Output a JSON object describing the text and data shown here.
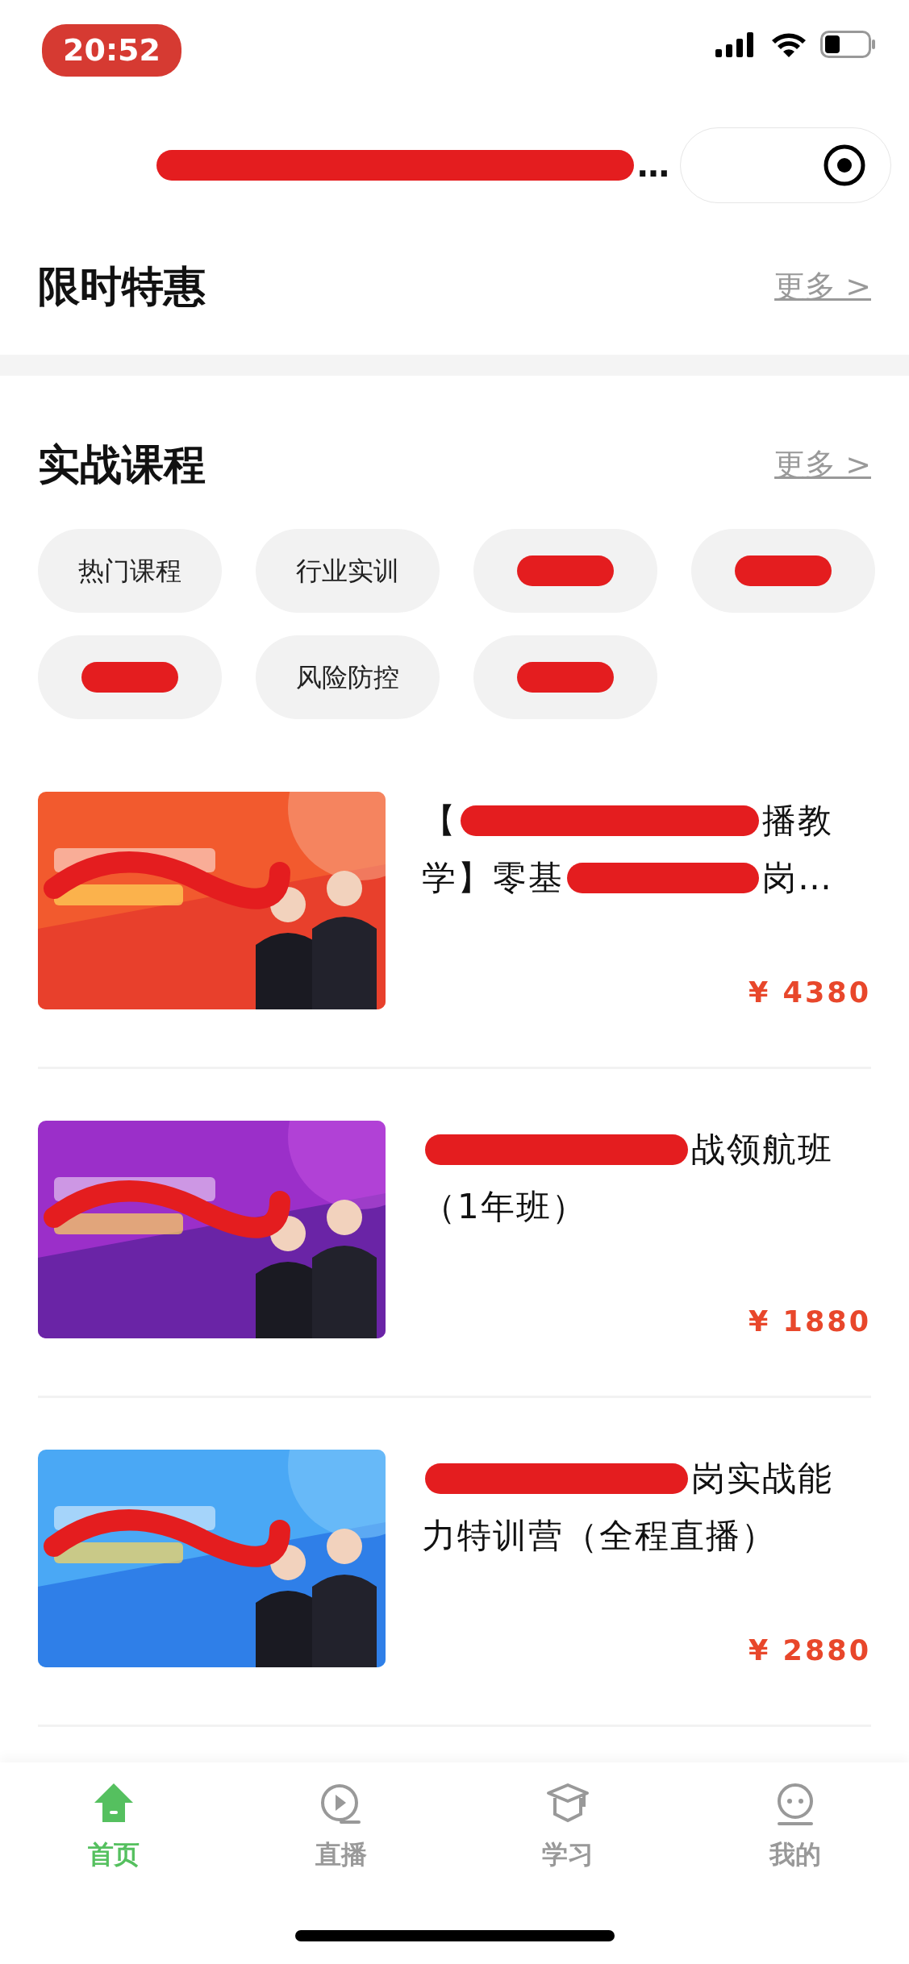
{
  "status_bar": {
    "time": "20:52"
  },
  "nav": {
    "title_lines": [
      [
        {
          "kind": "redaction"
        },
        {
          "kind": "text",
          "text": "…"
        }
      ]
    ]
  },
  "sections": [
    {
      "title": "限时特惠",
      "more": "更多 >"
    },
    {
      "title": "实战课程",
      "more": "更多 >"
    }
  ],
  "chips": [
    {
      "kind": "text",
      "label": "热门课程"
    },
    {
      "kind": "text",
      "label": "行业实训"
    },
    {
      "kind": "redaction"
    },
    {
      "kind": "redaction"
    },
    {
      "kind": "redaction"
    },
    {
      "kind": "text",
      "label": "风险防控"
    },
    {
      "kind": "redaction"
    }
  ],
  "courses": [
    {
      "title_lines": [
        [
          {
            "kind": "text",
            "text": "【"
          },
          {
            "kind": "redaction"
          },
          {
            "kind": "text",
            "text": "播教"
          }
        ],
        [
          {
            "kind": "text",
            "text": "学】零基"
          },
          {
            "kind": "redaction"
          },
          {
            "kind": "text",
            "text": "岗…"
          }
        ]
      ],
      "price": "¥ 4380"
    },
    {
      "title_lines": [
        [
          {
            "kind": "redaction"
          },
          {
            "kind": "text",
            "text": "战领航班"
          }
        ],
        [
          {
            "kind": "text",
            "text": "（1年班）"
          }
        ]
      ],
      "price": "¥ 1880"
    },
    {
      "title_lines": [
        [
          {
            "kind": "redaction"
          },
          {
            "kind": "text",
            "text": "岗实战能"
          }
        ],
        [
          {
            "kind": "text",
            "text": "力特训营（全程直播）"
          }
        ]
      ],
      "price": "¥ 2880"
    }
  ],
  "tabs": [
    {
      "label": "首页",
      "selected": true
    },
    {
      "label": "直播",
      "selected": false
    },
    {
      "label": "学习",
      "selected": false
    },
    {
      "label": "我的",
      "selected": false
    }
  ]
}
